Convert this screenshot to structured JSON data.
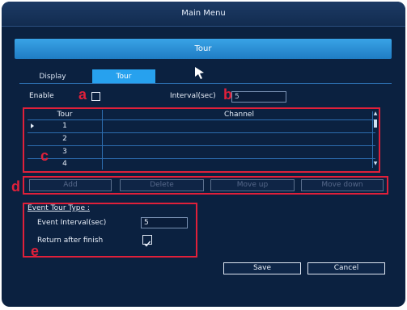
{
  "window": {
    "title": "Main Menu"
  },
  "panel": {
    "title": "Tour"
  },
  "tabs": [
    {
      "label": "Display",
      "active": false
    },
    {
      "label": "Tour",
      "active": true
    }
  ],
  "enable": {
    "label": "Enable",
    "checked": false
  },
  "interval": {
    "label": "Interval(sec)",
    "value": "5"
  },
  "table": {
    "headers": [
      "Tour",
      "Channel"
    ],
    "rows": [
      {
        "tour": "1",
        "channel": "",
        "selected": true
      },
      {
        "tour": "2",
        "channel": ""
      },
      {
        "tour": "3",
        "channel": ""
      },
      {
        "tour": "4",
        "channel": ""
      }
    ]
  },
  "buttons": {
    "add": "Add",
    "delete": "Delete",
    "move_up": "Move up",
    "move_down": "Move down"
  },
  "event": {
    "title": "Event Tour Type :",
    "interval_label": "Event Interval(sec)",
    "interval_value": "5",
    "return_label": "Return after finish",
    "return_checked": true
  },
  "footer": {
    "save": "Save",
    "cancel": "Cancel"
  },
  "annotations": [
    "a",
    "b",
    "c",
    "d",
    "e"
  ],
  "colors": {
    "background": "#0b2140",
    "accent": "#27a1ee",
    "annotation": "#e0203a"
  }
}
